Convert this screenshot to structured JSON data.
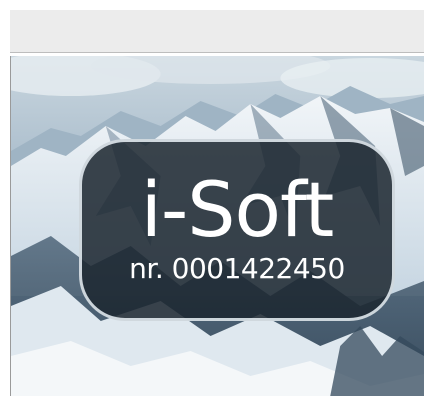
{
  "window": {
    "title": ""
  },
  "splash": {
    "brand": "i-Soft",
    "serial": "nr. 0001422450"
  },
  "colors": {
    "badge_background": "#1c2630",
    "badge_border": "#ebf2f8",
    "text": "#ffffff",
    "titlebar": "#ececec"
  }
}
